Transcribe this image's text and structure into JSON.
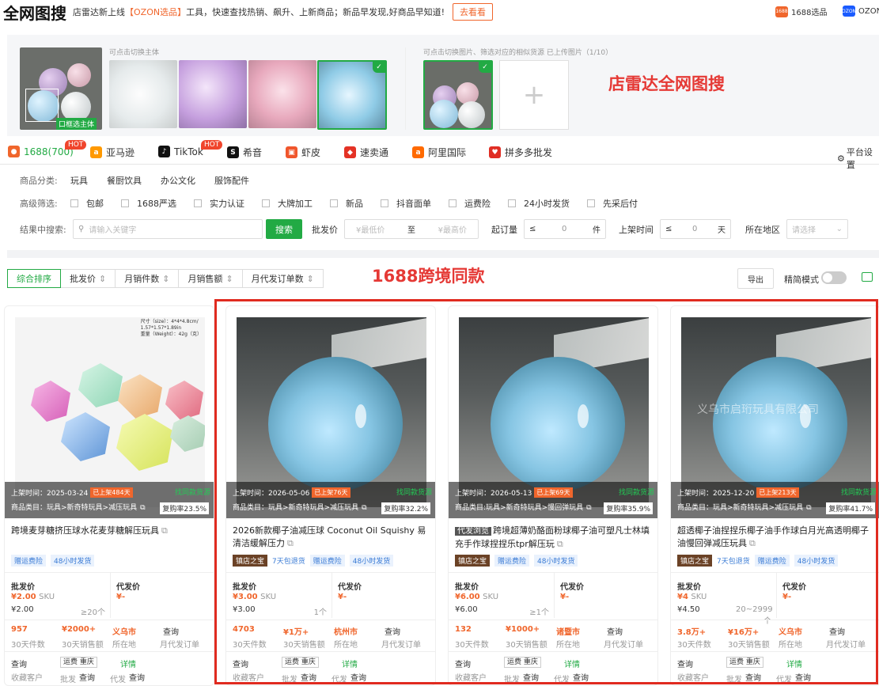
{
  "header": {
    "logo": "全网图搜",
    "notice_pre": "店雷达新上线",
    "notice_hl": "【OZON选品】",
    "notice_post": "工具，快速查找热销、飙升、上新商品；新品早发现,好商品早知道!",
    "go_label": "去看看",
    "ext1": "1688选品",
    "ext2": "OZON"
  },
  "selector": {
    "hint_left": "可点击切换主体",
    "hint_right": "可点击切换图片、筛选对应的相似货源 已上传图片（1/10）",
    "frame_label": "口框选主体",
    "title": "店雷达全网图搜"
  },
  "platforms": [
    {
      "label": "1688(700)",
      "hot": "HOT"
    },
    {
      "label": "亚马逊"
    },
    {
      "label": "TikTok",
      "hot": "HOT"
    },
    {
      "label": "希音"
    },
    {
      "label": "虾皮"
    },
    {
      "label": "速卖通"
    },
    {
      "label": "阿里国际"
    },
    {
      "label": "拼多多批发"
    }
  ],
  "platform_settings": "平台设置",
  "filters": {
    "category_label": "商品分类:",
    "categories": [
      "玩具",
      "餐厨饮具",
      "办公文化",
      "服饰配件"
    ],
    "advanced_label": "高级筛选:",
    "checks": [
      "包邮",
      "1688严选",
      "实力认证",
      "大牌加工",
      "新品",
      "抖音面单",
      "运费险",
      "24小时发货",
      "先采后付"
    ],
    "search_label": "结果中搜索:",
    "search_placeholder": "请输入关键字",
    "search_button": "搜索",
    "price_label": "批发价",
    "price_min": "¥最低价",
    "price_to": "至",
    "price_max": "¥最高价",
    "moq_label": "起订量",
    "moq_op": "≤",
    "moq_val": "0",
    "moq_unit": "件",
    "list_label": "上架时间",
    "list_op": "≤",
    "list_val": "0",
    "list_unit": "天",
    "region_label": "所在地区",
    "region_placeholder": "请选择"
  },
  "sort": [
    "综合排序",
    "批发价",
    "月销件数",
    "月销售额",
    "月代发订单数"
  ],
  "cross_title": "1688跨境同款",
  "toolbar": {
    "export": "导出",
    "simple": "精简模式"
  },
  "cards": [
    {
      "list_time": "上架时间：2025-03-24",
      "age": "已上架484天",
      "right_tag": "找同款货源",
      "category": "商品类目：玩具>新奇特玩具>减压玩具",
      "repurchase": "复购率23.5%",
      "title": "跨境麦芽糖挤压球水花麦芽糖解压玩具",
      "tags": [
        {
          "t": "赠运费险",
          "c": ""
        },
        {
          "t": "48小时发货",
          "c": ""
        }
      ],
      "price_label": "批发价",
      "price": "¥2.00",
      "sku": "SKU",
      "price2": "¥2.00",
      "moq": "≥20个",
      "dropship_label": "代发价",
      "dropship": "¥-",
      "s1": "957",
      "s1l": "30天件数",
      "s2": "¥2000+",
      "s2l": "30天销售额",
      "loc": "义乌市",
      "locl": "所在地",
      "q": "查询",
      "ql": "月代发订单",
      "b1": "查询",
      "b1l": "收藏客户",
      "ship": "运费 重庆",
      "detail": "详情",
      "b2l": "批发",
      "b2": "查询",
      "b3l": "代发",
      "b3": "查询",
      "img": "gems"
    },
    {
      "list_time": "上架时间：2026-05-06",
      "age": "已上架76天",
      "right_tag": "找同款货源",
      "category": "商品类目：玩具>新奇特玩具>减压玩具",
      "repurchase": "复购率32.2%",
      "title": "2026新款椰子油减压球 Coconut Oil Squishy 易清洁缓解压力",
      "tags": [
        {
          "t": "镇店之宝",
          "c": "dark"
        },
        {
          "t": "7天包退货",
          "c": "plain"
        },
        {
          "t": "赠运费险",
          "c": ""
        },
        {
          "t": "48小时发货",
          "c": ""
        }
      ],
      "price_label": "批发价",
      "price": "¥3.00",
      "sku": "SKU",
      "price2": "¥3.00",
      "moq": "1个",
      "dropship_label": "代发价",
      "dropship": "¥-",
      "s1": "4703",
      "s1l": "30天件数",
      "s2": "¥1万+",
      "s2l": "30天销售额",
      "loc": "杭州市",
      "locl": "所在地",
      "q": "查询",
      "ql": "月代发订单",
      "b1": "查询",
      "b1l": "收藏客户",
      "ship": "运费 重庆",
      "detail": "详情",
      "b2l": "批发",
      "b2": "查询",
      "b3l": "代发",
      "b3": "查询",
      "img": "ball"
    },
    {
      "list_time": "上架时间：2026-05-13",
      "age": "已上架69天",
      "right_tag": "找同款货源",
      "category": "商品类目:玩具>新奇特玩具>慢回弹玩具",
      "repurchase": "复购率35.9%",
      "title_badge": "代发浏览",
      "title": "跨境超薄奶酪面粉球椰子油可塑凡士林填充手作球捏捏乐tpr解压玩",
      "tags": [
        {
          "t": "镇店之宝",
          "c": "dark"
        },
        {
          "t": "赠运费险",
          "c": ""
        },
        {
          "t": "48小时发货",
          "c": ""
        }
      ],
      "price_label": "批发价",
      "price": "¥6.00",
      "sku": "SKU",
      "price2": "¥6.00",
      "moq": "≥1个",
      "dropship_label": "代发价",
      "dropship": "¥-",
      "s1": "132",
      "s1l": "30天件数",
      "s2": "¥1000+",
      "s2l": "30天销售额",
      "loc": "诸暨市",
      "locl": "所在地",
      "q": "查询",
      "ql": "月代发订单",
      "b1": "查询",
      "b1l": "收藏客户",
      "ship": "运费 重庆",
      "detail": "详情",
      "b2l": "批发",
      "b2": "查询",
      "b3l": "代发",
      "b3": "查询",
      "img": "ball"
    },
    {
      "list_time": "上架时间：2025-12-20",
      "age": "已上架213天",
      "right_tag": "找同款货源",
      "category": "商品类目：玩具>新奇特玩具>减压玩具",
      "repurchase": "复购率41.7%",
      "title": "超透椰子油捏捏乐椰子油手作球白月光高透明椰子油慢回弹减压玩具",
      "tags": [
        {
          "t": "镇店之宝",
          "c": "dark"
        },
        {
          "t": "7天包退货",
          "c": "plain"
        },
        {
          "t": "赠运费险",
          "c": ""
        },
        {
          "t": "48小时发货",
          "c": ""
        }
      ],
      "price_label": "批发价",
      "price": "¥4",
      "sku": "SKU",
      "price2": "¥4.50",
      "moq": "20~2999个",
      "dropship_label": "代发价",
      "dropship": "¥-",
      "s1": "3.8万+",
      "s1l": "30天件数",
      "s2": "¥16万+",
      "s2l": "30天销售额",
      "loc": "义乌市",
      "locl": "所在地",
      "q": "查询",
      "ql": "月代发订单",
      "b1": "查询",
      "b1l": "收藏客户",
      "ship": "运费 重庆",
      "detail": "详情",
      "b2l": "批发",
      "b2": "查询",
      "b3l": "代发",
      "b3": "查询",
      "watermark": "义乌市启珩玩具有限公司",
      "img": "ball"
    }
  ]
}
